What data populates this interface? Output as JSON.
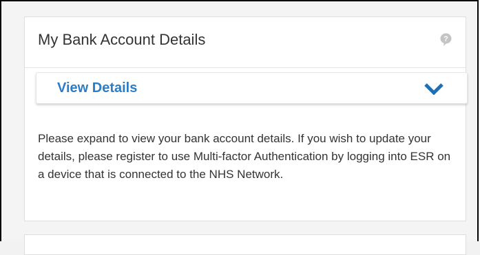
{
  "card": {
    "title": "My Bank Account Details",
    "help_icon": "speech-bubble-help-icon"
  },
  "accordion": {
    "label": "View Details",
    "icon": "chevron-down-icon",
    "expanded": false,
    "accent_color": "#2c7cc6"
  },
  "description": "Please expand to view your bank account details. If you wish to update your details, please register to use Multi-factor Authentication by logging into ESR on a device that is connected to the NHS Network."
}
